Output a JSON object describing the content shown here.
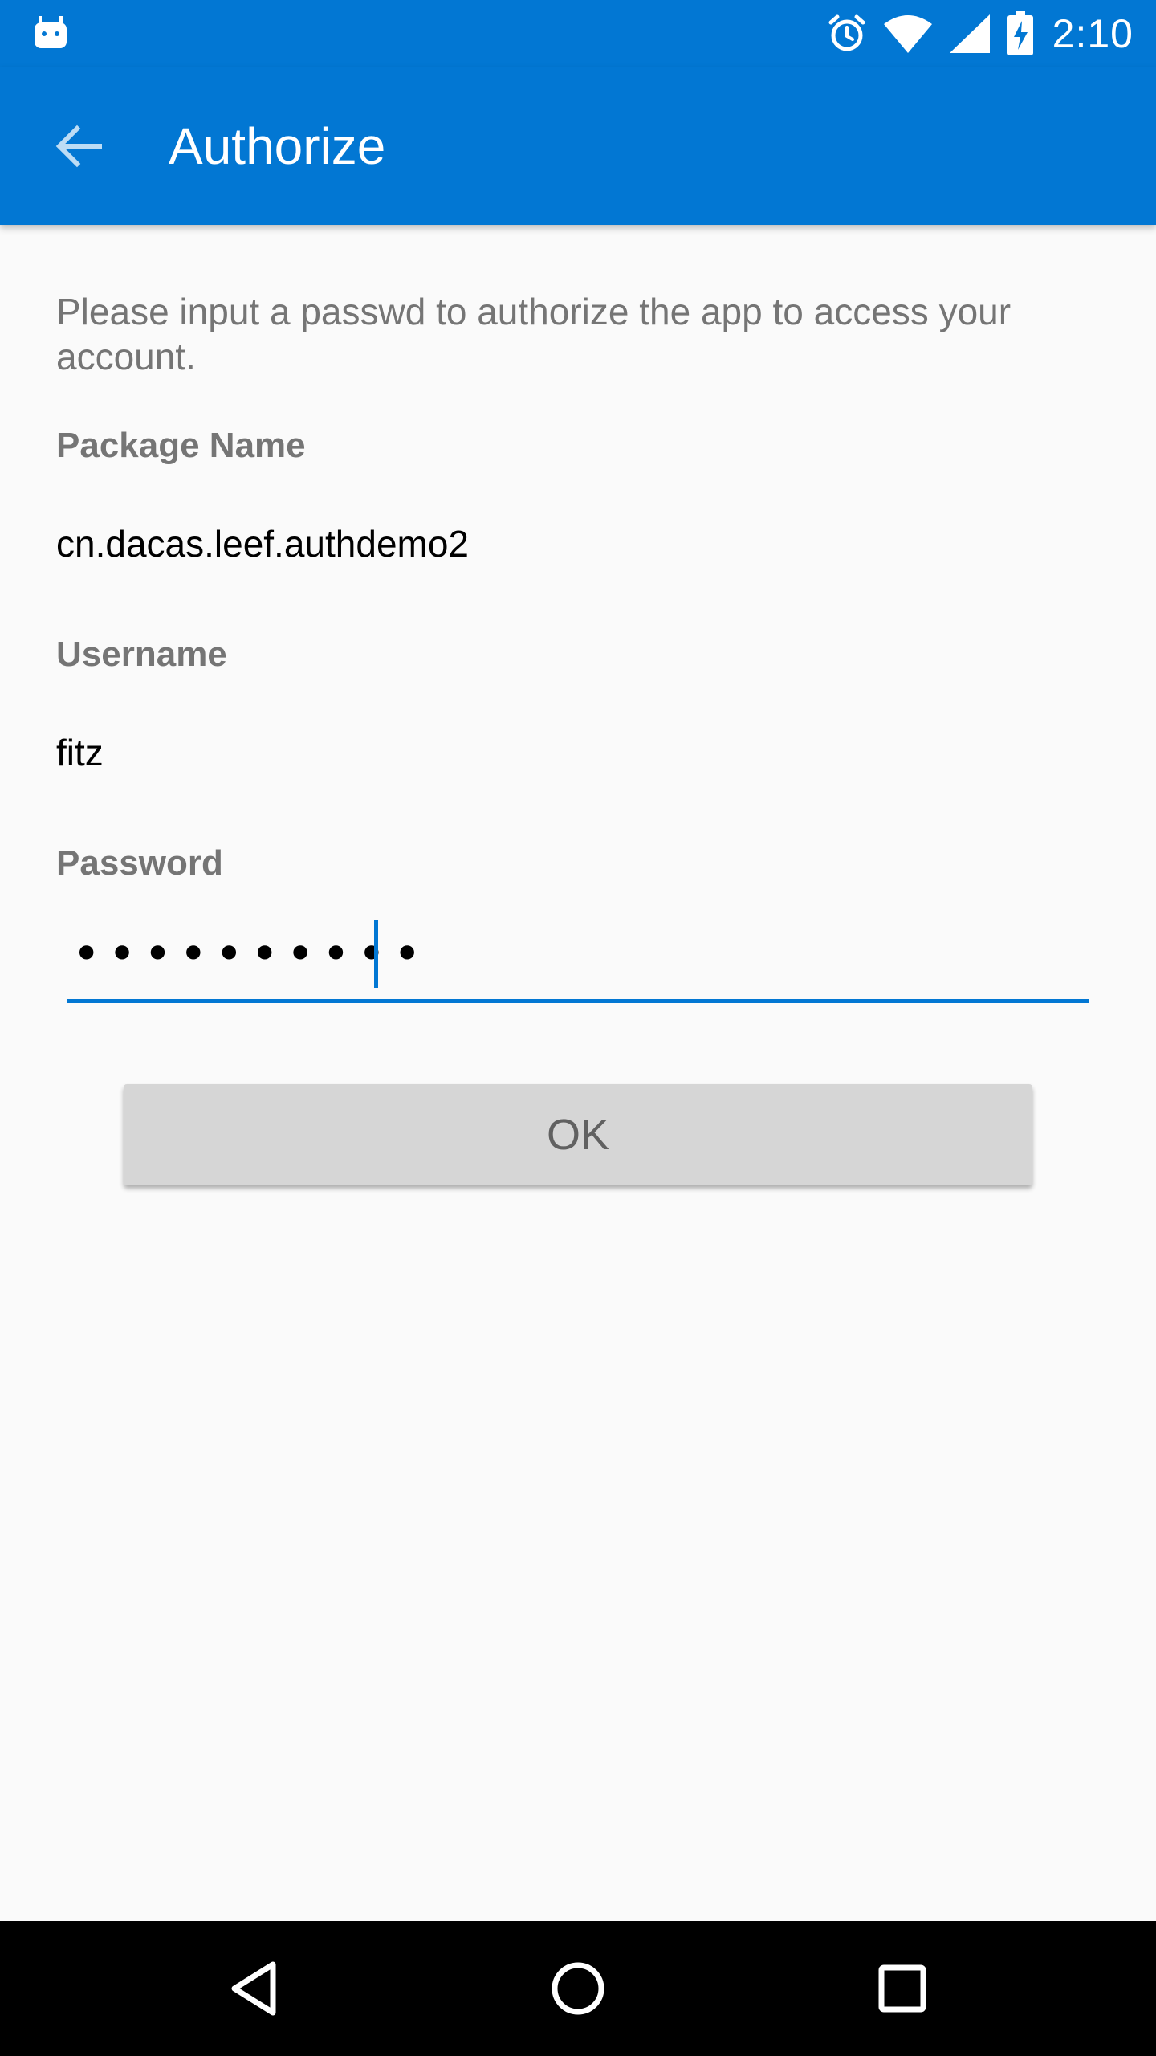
{
  "status_bar": {
    "time": "2:10",
    "icons": [
      "android-icon",
      "alarm-icon",
      "wifi-icon",
      "cell-signal-icon",
      "battery-charging-icon"
    ]
  },
  "app_bar": {
    "title": "Authorize",
    "back_icon": "arrow-back-icon"
  },
  "form": {
    "intro": "Please input a passwd to authorize the app to access your account.",
    "package_label": "Package Name",
    "package_value": "cn.dacas.leef.authdemo2",
    "username_label": "Username",
    "username_value": "fitz",
    "password_label": "Password",
    "password_masked": "••••••••••",
    "ok_label": "OK"
  },
  "nav_bar": {
    "buttons": [
      "back-triangle-icon",
      "home-circle-icon",
      "recents-square-icon"
    ]
  },
  "colors": {
    "primary": "#0277d3",
    "background": "#fafafa",
    "label": "#757575",
    "button_bg": "#d6d6d6"
  }
}
